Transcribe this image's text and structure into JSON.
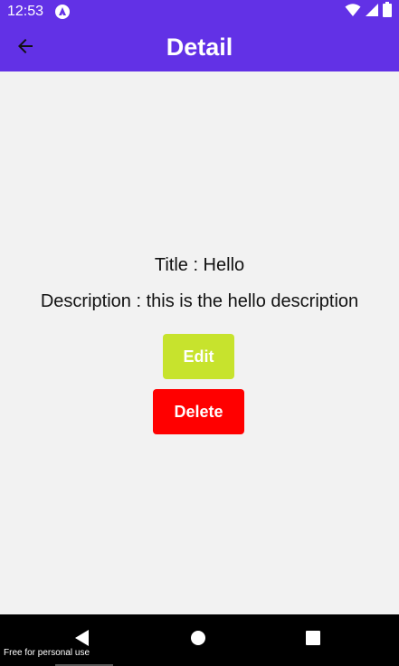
{
  "status_bar": {
    "time": "12:53",
    "background_color": "#6231e6",
    "icons": [
      "app-notification-icon",
      "wifi-icon",
      "signal-icon",
      "battery-icon"
    ]
  },
  "app_bar": {
    "title": "Detail",
    "back_icon": "arrow-left-icon",
    "background_color": "#6231e6"
  },
  "detail": {
    "title_text": "Title : Hello",
    "description_text": "Description : this is the hello description"
  },
  "actions": {
    "edit_label": "Edit",
    "edit_color": "#c7e32d",
    "delete_label": "Delete",
    "delete_color": "#ff0000"
  },
  "nav_bar": {
    "buttons": [
      "back-triangle-icon",
      "home-circle-icon",
      "recents-square-icon"
    ]
  },
  "watermark": "Free for personal use"
}
